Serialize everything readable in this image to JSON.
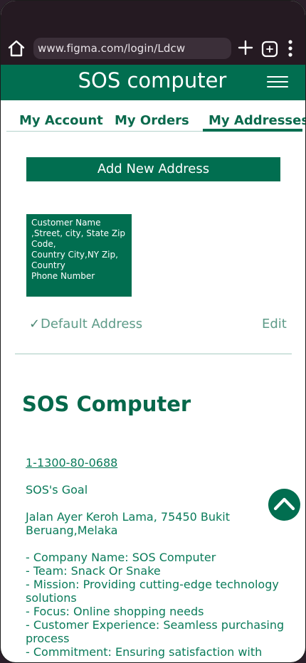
{
  "browser": {
    "url": "www.figma.com/login/Ldcw"
  },
  "header": {
    "title": "SOS computer"
  },
  "tabs": [
    {
      "label": "My Account"
    },
    {
      "label": "My Orders"
    },
    {
      "label": "My Addresses"
    }
  ],
  "add_address_label": "Add New Address",
  "address_card": {
    "lines": [
      "Customer Name",
      ",Street, city, State Zip",
      "Code,",
      "Country City,NY Zip,",
      "Country",
      "Phone Number"
    ]
  },
  "default_address": {
    "check": "✓",
    "label": "Default Address",
    "edit_label": "Edit"
  },
  "footer": {
    "title": "SOS Computer",
    "phone": "1-1300-80-0688",
    "goal": "SOS's Goal",
    "address": "Jalan Ayer Keroh Lama, 75450 Bukit Beruang,Melaka",
    "items": [
      "- Company Name: SOS Computer",
      "- Team: Snack Or Snake",
      "- Mission: Providing cutting-edge technology solutions",
      "- Focus: Online shopping needs",
      "- Customer Experience: Seamless purchasing process",
      "- Commitment: Ensuring satisfaction with"
    ]
  },
  "colors": {
    "brand": "#016e50",
    "chrome": "#251a22",
    "text_green": "#0a7b5a"
  }
}
